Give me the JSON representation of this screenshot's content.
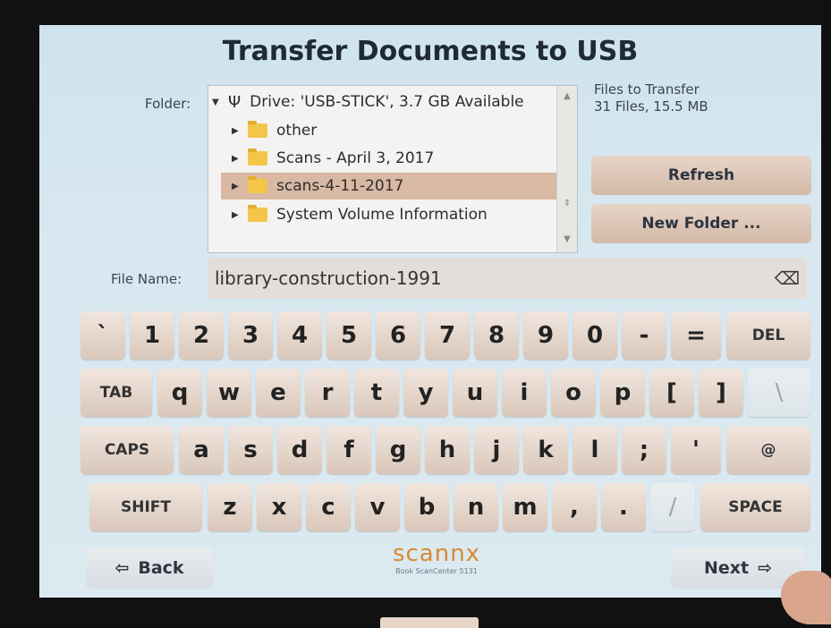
{
  "header": {
    "title": "Transfer Documents to USB"
  },
  "folder": {
    "label": "Folder:",
    "drive": "Drive: 'USB-STICK', 3.7 GB Available",
    "items": [
      {
        "label": "other"
      },
      {
        "label": "Scans - April 3, 2017"
      },
      {
        "label": "scans-4-11-2017",
        "selected": true
      },
      {
        "label": "System Volume Information"
      }
    ]
  },
  "transfer": {
    "label": "Files to Transfer",
    "summary": "31 Files, 15.5 MB"
  },
  "buttons": {
    "refresh": "Refresh",
    "new_folder": "New Folder ..."
  },
  "file_name": {
    "label": "File Name:",
    "value": "library-construction-1991"
  },
  "keyboard": {
    "row1": [
      "`",
      "1",
      "2",
      "3",
      "4",
      "5",
      "6",
      "7",
      "8",
      "9",
      "0",
      "-",
      "=",
      "DEL"
    ],
    "row2": [
      "TAB",
      "q",
      "w",
      "e",
      "r",
      "t",
      "y",
      "u",
      "i",
      "o",
      "p",
      "[",
      "]",
      "\\"
    ],
    "row3": [
      "CAPS",
      "a",
      "s",
      "d",
      "f",
      "g",
      "h",
      "j",
      "k",
      "l",
      ";",
      "'",
      "@"
    ],
    "row4": [
      "SHIFT",
      "z",
      "x",
      "c",
      "v",
      "b",
      "n",
      "m",
      ",",
      ".",
      "/",
      "SPACE"
    ]
  },
  "brand": {
    "name": "scannx",
    "model": "Book ScanCenter 5131"
  },
  "nav": {
    "back": "Back",
    "next": "Next"
  }
}
